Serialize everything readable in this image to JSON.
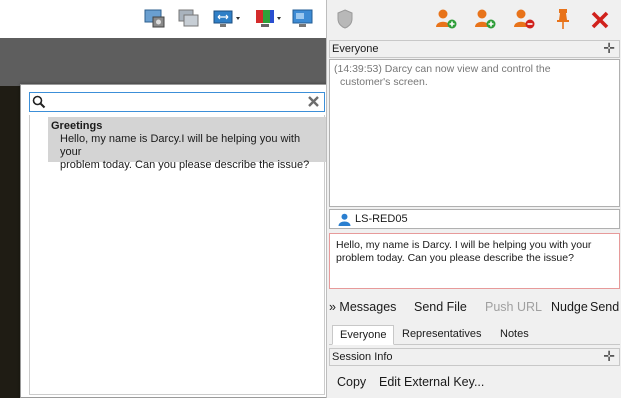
{
  "toolbar": {
    "left_icons": [
      "screenshot-icon",
      "copy-window-icon",
      "screen-size-icon",
      "color-depth-icon",
      "monitor-icon"
    ],
    "right_icons": [
      "shield-icon",
      "add-rep-icon",
      "invite-rep-icon",
      "remove-rep-icon",
      "pin-icon",
      "close-icon"
    ],
    "accent_orange": "#e8731a",
    "close_red": "#d0211c"
  },
  "popup": {
    "search_value": "",
    "items": [
      {
        "title": "Greetings",
        "body_line1": "Hello, my name is Darcy.I will be helping you with your",
        "body_line2": "problem today. Can you please describe the issue?"
      }
    ]
  },
  "chat": {
    "header": "Everyone",
    "log_line1": "(14:39:53) Darcy can now view and control the",
    "log_line2": "customer's screen."
  },
  "user": {
    "name": "LS-RED05"
  },
  "compose": {
    "line1": "Hello, my name is Darcy.  I will be helping you with your",
    "line2": "problem today.  Can you please describe the issue?"
  },
  "actions": {
    "messages": "» Messages",
    "send_file": "Send File",
    "push_url": "Push URL",
    "nudge": "Nudge",
    "send": "Send"
  },
  "tabs": [
    "Everyone",
    "Representatives",
    "Notes"
  ],
  "session": {
    "header": "Session Info",
    "copy": "Copy",
    "edit_key": "Edit External Key..."
  }
}
